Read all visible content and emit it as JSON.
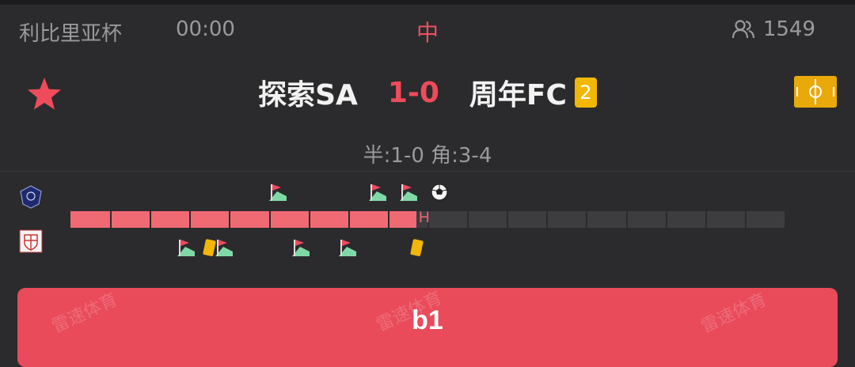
{
  "header": {
    "league": "利比里亚杯",
    "time": "00:00",
    "status": "中",
    "viewers": "1549",
    "viewers_icon": "users-icon"
  },
  "match": {
    "home_team": "探索SA",
    "score": "1-0",
    "away_team": "周年FC",
    "away_red_cards": "2",
    "favorite_icon": "star-icon",
    "pitch_icon": "pitch-icon"
  },
  "stats": {
    "summary": "半:1-0 角:3-4"
  },
  "timeline": {
    "progress_fraction": 0.485,
    "half_marker": "H",
    "home_events": [
      {
        "type": "corner",
        "minute": 27
      },
      {
        "type": "corner",
        "minute": 40
      },
      {
        "type": "corner",
        "minute": 44
      },
      {
        "type": "goal",
        "minute": 48
      }
    ],
    "away_events": [
      {
        "type": "corner",
        "minute": 15
      },
      {
        "type": "yellow-card",
        "minute": 18
      },
      {
        "type": "corner",
        "minute": 20
      },
      {
        "type": "corner",
        "minute": 30
      },
      {
        "type": "corner",
        "minute": 36
      },
      {
        "type": "yellow-card",
        "minute": 45
      }
    ]
  },
  "action": {
    "button_label": "b1",
    "watermark": "雷速体育"
  },
  "colors": {
    "accent": "#e94b5b",
    "background": "#2b2b2d",
    "card_yellow": "#f2b705"
  }
}
